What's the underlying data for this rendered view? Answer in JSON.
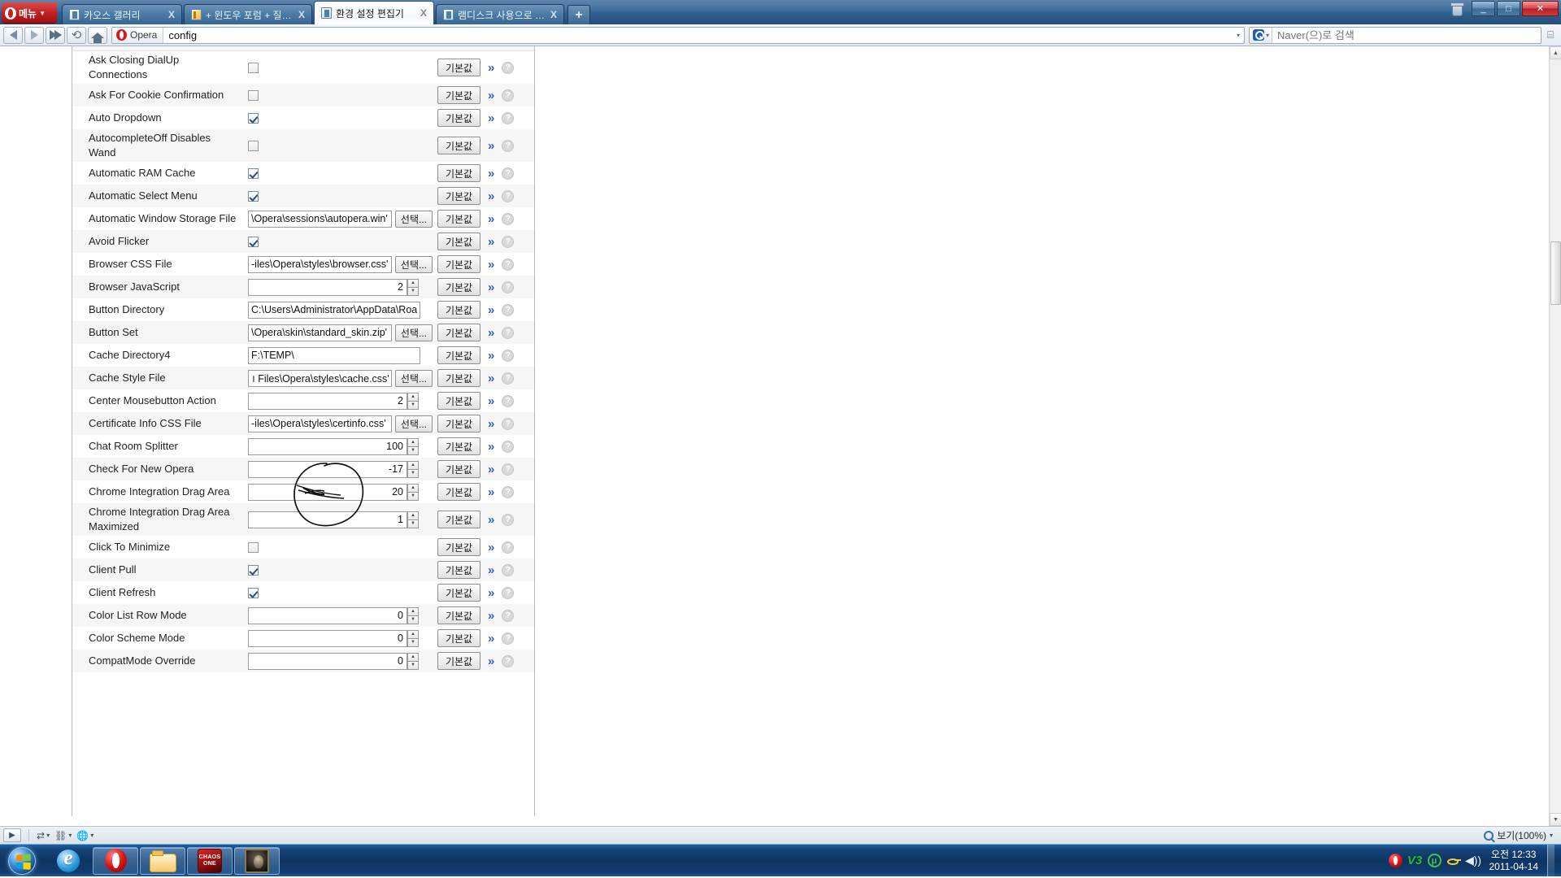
{
  "window": {
    "opera_menu_label": "메뉴",
    "minimize_label": "_",
    "maximize_label": "□",
    "close_label": "✕",
    "trash_icon": "trash-icon"
  },
  "tabs": [
    {
      "title": "카오스 갤러리",
      "close": "X",
      "active": false
    },
    {
      "title": "+ 윈도우 포럼 + 질문...",
      "close": "X",
      "active": false
    },
    {
      "title": "환경 설정 편집기",
      "close": "X",
      "active": true
    },
    {
      "title": "램디스크 사용으로 인...",
      "close": "X",
      "active": false
    }
  ],
  "tab_new_label": "+",
  "navbar": {
    "back": "◀",
    "forward": "▶",
    "fastforward": "▶▶",
    "reload": "⟳",
    "home": "⌂",
    "opera_badge": "Opera",
    "url_value": "config",
    "url_placeholder": "",
    "search_value": "",
    "search_placeholder": "Naver(으)로 검색",
    "dropdown_caret": "▾"
  },
  "config": {
    "rows": [
      {
        "label": "Ask Closing DialUp Connections",
        "type": "checkbox",
        "checked": false,
        "default_label": "기본값",
        "chevron": "»",
        "help": "?"
      },
      {
        "label": "Ask For Cookie Confirmation",
        "type": "checkbox",
        "checked": false,
        "default_label": "기본값",
        "chevron": "»",
        "help": "?"
      },
      {
        "label": "Auto Dropdown",
        "type": "checkbox",
        "checked": true,
        "default_label": "기본값",
        "chevron": "»",
        "help": "?"
      },
      {
        "label": "AutocompleteOff Disables Wand",
        "type": "checkbox",
        "checked": false,
        "default_label": "기본값",
        "chevron": "»",
        "help": "?"
      },
      {
        "label": "Automatic RAM Cache",
        "type": "checkbox",
        "checked": true,
        "default_label": "기본값",
        "chevron": "»",
        "help": "?"
      },
      {
        "label": "Automatic Select Menu",
        "type": "checkbox",
        "checked": true,
        "default_label": "기본값",
        "chevron": "»",
        "help": "?"
      },
      {
        "label": "Automatic Window Storage File",
        "type": "file",
        "value": "\\Opera\\sessions\\autopera.win'",
        "select_label": "선택...",
        "default_label": "기본값",
        "chevron": "»",
        "help": "?"
      },
      {
        "label": "Avoid Flicker",
        "type": "checkbox",
        "checked": true,
        "default_label": "기본값",
        "chevron": "»",
        "help": "?"
      },
      {
        "label": "Browser CSS File",
        "type": "file",
        "value": "-iles\\Opera\\styles\\browser.css'",
        "select_label": "선택...",
        "default_label": "기본값",
        "chevron": "»",
        "help": "?"
      },
      {
        "label": "Browser JavaScript",
        "type": "number",
        "value": "2",
        "default_label": "기본값",
        "chevron": "»",
        "help": "?"
      },
      {
        "label": "Button Directory",
        "type": "text",
        "value": "C:\\Users\\Administrator\\AppData\\Roaming\\O",
        "default_label": "기본값",
        "chevron": "»",
        "help": "?"
      },
      {
        "label": "Button Set",
        "type": "file",
        "value": "\\Opera\\skin\\standard_skin.zip'",
        "select_label": "선택...",
        "default_label": "기본값",
        "chevron": "»",
        "help": "?"
      },
      {
        "label": "Cache Directory4",
        "type": "text",
        "value": "F:\\TEMP\\",
        "default_label": "기본값",
        "chevron": "»",
        "help": "?"
      },
      {
        "label": "Cache Style File",
        "type": "file",
        "value": "। Files\\Opera\\styles\\cache.css'",
        "select_label": "선택...",
        "default_label": "기본값",
        "chevron": "»",
        "help": "?"
      },
      {
        "label": "Center Mousebutton Action",
        "type": "number",
        "value": "2",
        "default_label": "기본값",
        "chevron": "»",
        "help": "?"
      },
      {
        "label": "Certificate Info CSS File",
        "type": "file",
        "value": "-iles\\Opera\\styles\\certinfo.css'",
        "select_label": "선택...",
        "default_label": "기본값",
        "chevron": "»",
        "help": "?"
      },
      {
        "label": "Chat Room Splitter",
        "type": "number",
        "value": "100",
        "default_label": "기본값",
        "chevron": "»",
        "help": "?"
      },
      {
        "label": "Check For New Opera",
        "type": "number",
        "value": "-17",
        "default_label": "기본값",
        "chevron": "»",
        "help": "?"
      },
      {
        "label": "Chrome Integration Drag Area",
        "type": "number",
        "value": "20",
        "default_label": "기본값",
        "chevron": "»",
        "help": "?"
      },
      {
        "label": "Chrome Integration Drag Area Maximized",
        "type": "number",
        "value": "1",
        "default_label": "기본값",
        "chevron": "»",
        "help": "?"
      },
      {
        "label": "Click To Minimize",
        "type": "checkbox",
        "checked": false,
        "default_label": "기본값",
        "chevron": "»",
        "help": "?"
      },
      {
        "label": "Client Pull",
        "type": "checkbox",
        "checked": true,
        "default_label": "기본값",
        "chevron": "»",
        "help": "?"
      },
      {
        "label": "Client Refresh",
        "type": "checkbox",
        "checked": true,
        "default_label": "기본값",
        "chevron": "»",
        "help": "?"
      },
      {
        "label": "Color List Row Mode",
        "type": "number",
        "value": "0",
        "default_label": "기본값",
        "chevron": "»",
        "help": "?"
      },
      {
        "label": "Color Scheme Mode",
        "type": "number",
        "value": "0",
        "default_label": "기본값",
        "chevron": "»",
        "help": "?"
      },
      {
        "label": "CompatMode Override",
        "type": "number",
        "value": "0",
        "default_label": "기본값",
        "chevron": "»",
        "help": "?"
      }
    ]
  },
  "annotation": {
    "shape": "hand-drawn-circle",
    "color": "#111111",
    "target": "Cache Directory4 value F:\\TEMP\\"
  },
  "statusbar": {
    "panel_toggle": "▶",
    "items": [
      "transfers-icon",
      "links-icon",
      "globe-icon"
    ],
    "zoom_label": "보기(100%)",
    "zoom_caret": "▾"
  },
  "taskbar": {
    "start_label": "start-orb",
    "items": [
      {
        "icon": "ie-icon",
        "name": "internet-explorer",
        "pinned": false
      },
      {
        "icon": "opera-icon",
        "name": "opera",
        "pinned": true
      },
      {
        "icon": "folder-icon",
        "name": "windows-explorer",
        "pinned": true
      },
      {
        "icon": "chaos-icon",
        "name": "chaos-one-game",
        "pinned": true,
        "line1": "CHAOS",
        "line2": "ONE"
      },
      {
        "icon": "portrait-icon",
        "name": "game-portrait",
        "pinned": true
      }
    ],
    "tray": [
      "opera-tray-icon",
      "v3-antivirus-icon",
      "utorrent-icon",
      "key-icon",
      "volume-icon"
    ],
    "v3_glyph": "V3",
    "ut_glyph": "μ",
    "vol_glyph": "🔊",
    "clock_time": "오전 12:33",
    "clock_date": "2011-04-14"
  }
}
